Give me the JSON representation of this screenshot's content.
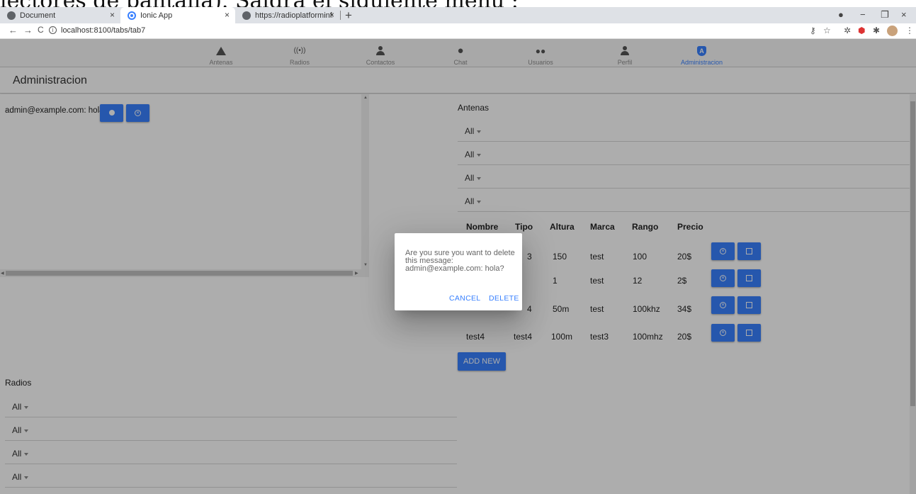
{
  "top_caption": "lectores de pantalla). Saldrá el siguiente menú :",
  "browser": {
    "tabs": [
      {
        "title": "Document",
        "close": "×"
      },
      {
        "title": "Ionic App",
        "close": "×"
      },
      {
        "title": "https://radioplatforminfrastructu",
        "close": "×"
      }
    ],
    "new_tab": "+",
    "window_controls": {
      "minimize": "−",
      "maximize": "❐",
      "close": "×"
    },
    "nav": {
      "back": "←",
      "forward": "→",
      "reload": "C"
    },
    "url": "localhost:8100/tabs/tab7",
    "url_info": "i"
  },
  "ion_tabs": [
    {
      "label": "Antenas",
      "icon": "triangle-icon"
    },
    {
      "label": "Radios",
      "icon": "radio-icon",
      "glyph": "((•))"
    },
    {
      "label": "Contactos",
      "icon": "person-icon"
    },
    {
      "label": "Chat",
      "icon": "chat-icon"
    },
    {
      "label": "Usuarios",
      "icon": "people-icon"
    },
    {
      "label": "Perfil",
      "icon": "person-icon"
    },
    {
      "label": "Administracion",
      "icon": "angular-shield-icon",
      "glyph": "A",
      "selected": true
    }
  ],
  "accent_color": "#3880ff",
  "page_title": "Administracion",
  "message_panel": {
    "message": "admin@example.com: hola"
  },
  "antenas": {
    "title": "Antenas",
    "filters": [
      "All",
      "All",
      "All",
      "All"
    ],
    "columns": [
      "Nombre",
      "Tipo",
      "Altura",
      "Marca",
      "Rango",
      "Precio"
    ],
    "rows": [
      {
        "nombre": "",
        "tipo": "3",
        "altura": "150",
        "marca": "test",
        "rango": "100",
        "precio": "20$"
      },
      {
        "nombre": "",
        "tipo": "",
        "altura": "1",
        "marca": "test",
        "rango": "12",
        "precio": "2$"
      },
      {
        "nombre": "",
        "tipo": "4",
        "altura": "50m",
        "marca": "test",
        "rango": "100khz",
        "precio": "34$"
      },
      {
        "nombre": "test4",
        "tipo": "test4",
        "altura": "100m",
        "marca": "test3",
        "rango": "100mhz",
        "precio": "20$"
      }
    ],
    "add_new": "ADD NEW"
  },
  "radios": {
    "title": "Radios",
    "filters": [
      "All",
      "All",
      "All",
      "All"
    ]
  },
  "dialog": {
    "message": "Are you sure you want to delete this message: admin@example.com: hola?",
    "cancel": "CANCEL",
    "delete": "DELETE"
  }
}
